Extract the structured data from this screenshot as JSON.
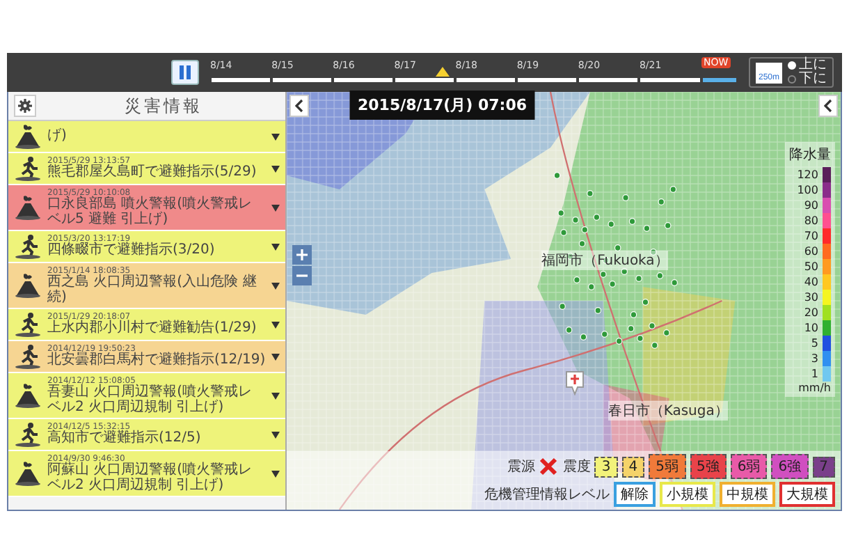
{
  "timeline": {
    "labels": [
      "8/14",
      "8/15",
      "8/16",
      "8/17",
      "8/18",
      "8/19",
      "8/20",
      "8/21"
    ],
    "now_label": "NOW",
    "level": 0.44,
    "current_time": "2015/8/17(月) 07:06"
  },
  "layer_toggle": {
    "icon_label": "250m",
    "options": [
      {
        "label": "上に",
        "selected": true
      },
      {
        "label": "下に",
        "selected": false
      }
    ]
  },
  "sidebar": {
    "title": "災害情報",
    "items": [
      {
        "kind": "volcano",
        "title": "げ)",
        "color": "#eef37a"
      },
      {
        "kind": "evacuation",
        "date": "2015/5/29 13:13:57",
        "title": "熊毛郡屋久島町で避難指示(5/29)",
        "color": "#eef37a"
      },
      {
        "kind": "volcano",
        "date": "2015/5/29 10:10:08",
        "title": "口永良部島 噴火警報(噴火警戒レベル5 避難 引上げ)",
        "color": "#f08a8a"
      },
      {
        "kind": "evacuation",
        "date": "2015/3/20 13:17:19",
        "title": "四條畷市で避難指示(3/20)",
        "color": "#eef37a"
      },
      {
        "kind": "volcano",
        "date": "2015/1/14 18:08:35",
        "title": "西之島 火口周辺警報(入山危険 継続)",
        "color": "#f6d592"
      },
      {
        "kind": "evacuation",
        "date": "2015/1/29 20:18:07",
        "title": "上水内郡小川村で避難勧告(1/29)",
        "color": "#eef37a"
      },
      {
        "kind": "evacuation",
        "date": "2014/12/19 19:50:23",
        "title": "北安曇郡白馬村で避難指示(12/19)",
        "color": "#f6d592"
      },
      {
        "kind": "volcano",
        "date": "2014/12/12 15:08:05",
        "title": "吾妻山 火口周辺警報(噴火警戒レベル2 火口周辺規制 引上げ)",
        "color": "#eef37a"
      },
      {
        "kind": "evacuation",
        "date": "2014/12/5 15:32:15",
        "title": "高知市で避難指示(12/5)",
        "color": "#eef37a"
      },
      {
        "kind": "volcano",
        "date": "2014/9/30 9:46:30",
        "title": "阿蘇山 火口周辺警報(噴火警戒レベル2 火口周辺規制 引上げ)",
        "color": "#eef37a"
      }
    ]
  },
  "map": {
    "place_labels": [
      "福岡市（Fukuoka）",
      "春日市（Kasuga）"
    ],
    "rain_legend": {
      "title": "降水量",
      "unit": "mm/h",
      "ticks": [
        {
          "label": "120",
          "color": "#5a1f5a"
        },
        {
          "label": "100",
          "color": "#8a2d8a"
        },
        {
          "label": "90",
          "color": "#d94fb0"
        },
        {
          "label": "80",
          "color": "#ff5090"
        },
        {
          "label": "70",
          "color": "#ff2a2a"
        },
        {
          "label": "60",
          "color": "#ff6a20"
        },
        {
          "label": "50",
          "color": "#ff9a20"
        },
        {
          "label": "40",
          "color": "#ffc820"
        },
        {
          "label": "30",
          "color": "#f5f520"
        },
        {
          "label": "20",
          "color": "#a0e020"
        },
        {
          "label": "10",
          "color": "#30b030"
        },
        {
          "label": "5",
          "color": "#2050e0"
        },
        {
          "label": "3",
          "color": "#3090f0"
        },
        {
          "label": "1",
          "color": "#70c8f0"
        }
      ]
    },
    "legend": {
      "epicenter_label": "震源",
      "intensity_label": "震度",
      "intensities": [
        {
          "label": "3",
          "color": "#f2f27a"
        },
        {
          "label": "4",
          "color": "#f5d36a"
        },
        {
          "label": "5弱",
          "color": "#f07a3a"
        },
        {
          "label": "5強",
          "color": "#e8434a"
        },
        {
          "label": "6弱",
          "color": "#e85aa8"
        },
        {
          "label": "6強",
          "color": "#d04fc0"
        },
        {
          "label": "7",
          "color": "#7a3f8a"
        }
      ],
      "crisis_label": "危機管理情報レベル",
      "crisis_levels": [
        {
          "label": "解除",
          "color": "#3aa0e0"
        },
        {
          "label": "小規模",
          "color": "#e8e84a"
        },
        {
          "label": "中規模",
          "color": "#f0b030"
        },
        {
          "label": "大規模",
          "color": "#e03030"
        }
      ]
    }
  }
}
